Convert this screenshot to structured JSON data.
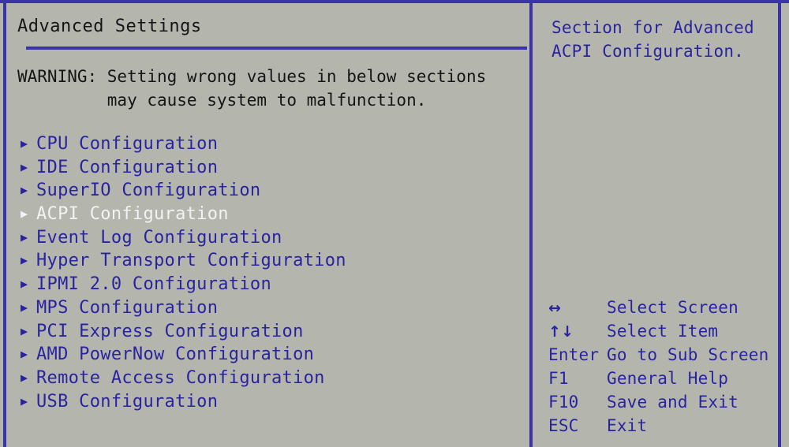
{
  "colors": {
    "background": "#b4b6ae",
    "border": "#3b34a8",
    "menu_text": "#2a23a0",
    "title_text": "#151515",
    "selected_text": "#f2f2f2"
  },
  "left": {
    "title": "Advanced Settings",
    "warning_line1": "WARNING: Setting wrong values in below sections",
    "warning_line2": "         may cause system to malfunction.",
    "bullet_glyph": "▶",
    "menu_items": [
      {
        "label": "CPU Configuration",
        "selected": false
      },
      {
        "label": "IDE Configuration",
        "selected": false
      },
      {
        "label": "SuperIO Configuration",
        "selected": false
      },
      {
        "label": "ACPI Configuration",
        "selected": true
      },
      {
        "label": "Event Log Configuration",
        "selected": false
      },
      {
        "label": "Hyper Transport Configuration",
        "selected": false
      },
      {
        "label": "IPMI 2.0 Configuration",
        "selected": false
      },
      {
        "label": "MPS Configuration",
        "selected": false
      },
      {
        "label": "PCI Express Configuration",
        "selected": false
      },
      {
        "label": "AMD PowerNow Configuration",
        "selected": false
      },
      {
        "label": "Remote Access Configuration",
        "selected": false
      },
      {
        "label": "USB Configuration",
        "selected": false
      }
    ]
  },
  "right": {
    "help_line1": "Section for Advanced",
    "help_line2": "ACPI Configuration.",
    "legend": [
      {
        "key": "↔",
        "desc": "Select Screen",
        "glyph": true
      },
      {
        "key": "↑↓",
        "desc": "Select Item",
        "glyph": true
      },
      {
        "key": "Enter",
        "desc": "Go to Sub Screen",
        "glyph": false
      },
      {
        "key": "F1",
        "desc": "General Help",
        "glyph": false
      },
      {
        "key": "F10",
        "desc": "Save and Exit",
        "glyph": false
      },
      {
        "key": "ESC",
        "desc": "Exit",
        "glyph": false
      }
    ]
  }
}
